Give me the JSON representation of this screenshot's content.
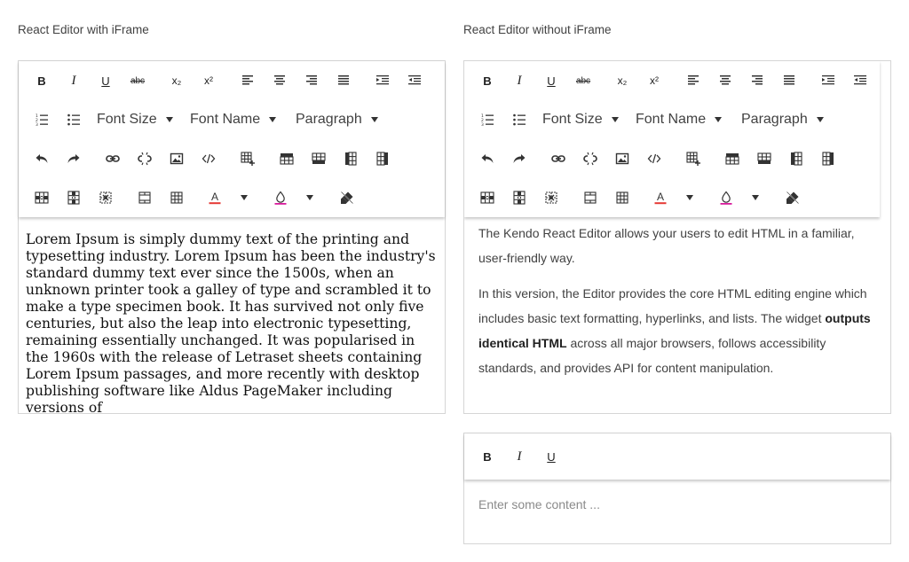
{
  "editor_iframe": {
    "title": "React Editor with iFrame",
    "content": "Lorem Ipsum is simply dummy text of the printing and typesetting industry. Lorem Ipsum has been the industry's standard dummy text ever since the 1500s, when an unknown printer took a galley of type and scrambled it to make a type specimen book. It has survived not only five centuries, but also the leap into electronic typesetting, remaining essentially unchanged. It was popularised in the 1960s with the release of Letraset sheets containing Lorem Ipsum passages, and more recently with desktop publishing software like Aldus PageMaker including versions of"
  },
  "editor_div": {
    "title": "React Editor without iFrame",
    "p1": "The Kendo React Editor allows your users to edit HTML in a familiar, user-friendly way.",
    "p2_before": "In this version, the Editor provides the core HTML editing engine which includes basic text formatting, hyperlinks, and lists. The widget",
    "p2_bold": "outputs identical HTML",
    "p2_after": "across all major browsers, follows accessibility standards, and provides API for content manipulation."
  },
  "editor_small": {
    "placeholder": "Enter some content ..."
  },
  "toolbar": {
    "bold": "B",
    "italic": "I",
    "underline": "U",
    "strikethrough": "abc",
    "subscript": "x₂",
    "superscript": "x²",
    "font_size": "Font Size",
    "font_name": "Font Name",
    "format": "Paragraph",
    "icons": [
      "bold-icon",
      "italic-icon",
      "underline-icon",
      "strikethrough-icon",
      "subscript-icon",
      "superscript-icon",
      "align-left-icon",
      "align-center-icon",
      "align-right-icon",
      "align-justify-icon",
      "indent-icon",
      "outdent-icon",
      "ordered-list-icon",
      "unordered-list-icon",
      "undo-icon",
      "redo-icon",
      "link-icon",
      "unlink-icon",
      "image-icon",
      "view-html-icon",
      "insert-table-icon",
      "add-row-above-icon",
      "add-row-below-icon",
      "add-column-before-icon",
      "add-column-after-icon",
      "delete-row-icon",
      "delete-column-icon",
      "delete-table-icon",
      "merge-cells-icon",
      "split-cell-icon",
      "foreground-color-icon",
      "background-color-icon",
      "clean-formatting-icon"
    ]
  },
  "colors": {
    "accent_red": "#e53935",
    "accent_magenta": "#d81b9c",
    "toolbar_icon": "#333333",
    "border": "#d5d5d5"
  }
}
